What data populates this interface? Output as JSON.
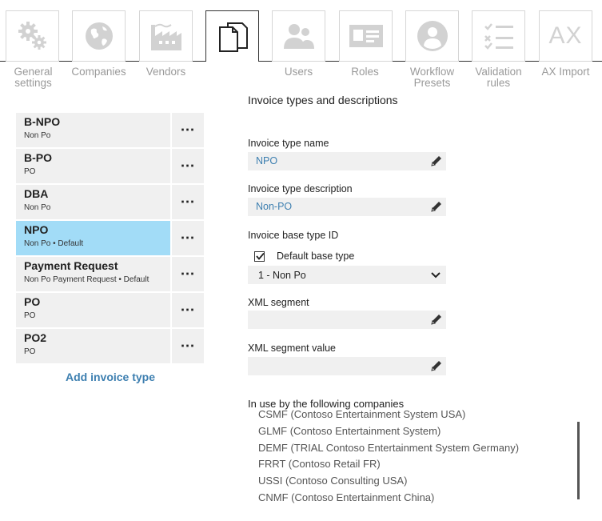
{
  "nav": {
    "items": [
      {
        "label": "General settings",
        "icon": "gears-icon"
      },
      {
        "label": "Companies",
        "icon": "globe-icon"
      },
      {
        "label": "Vendors",
        "icon": "factory-icon"
      },
      {
        "label": "",
        "icon": "documents-icon",
        "active": true
      },
      {
        "label": "Users",
        "icon": "users-icon"
      },
      {
        "label": "Roles",
        "icon": "id-card-icon"
      },
      {
        "label": "Workflow Presets",
        "icon": "user-circle-icon"
      },
      {
        "label": "Validation rules",
        "icon": "checklist-icon"
      },
      {
        "label": "AX Import",
        "icon": "ax-icon",
        "icon_text": "AX"
      }
    ]
  },
  "invoice_types": {
    "items": [
      {
        "name": "B-NPO",
        "sub": "Non Po",
        "selected": false
      },
      {
        "name": "B-PO",
        "sub": "PO",
        "selected": false
      },
      {
        "name": "DBA",
        "sub": "Non Po",
        "selected": false
      },
      {
        "name": "NPO",
        "sub": "Non Po • Default",
        "selected": true
      },
      {
        "name": "Payment Request",
        "sub": "Non Po Payment Request • Default",
        "selected": false
      },
      {
        "name": "PO",
        "sub": "PO",
        "selected": false
      },
      {
        "name": "PO2",
        "sub": "PO",
        "selected": false
      }
    ],
    "more_label": "⋯",
    "add_label": "Add invoice type"
  },
  "form": {
    "section_title": "Invoice types and descriptions",
    "name_label": "Invoice type name",
    "name_value": "NPO",
    "description_label": "Invoice type description",
    "description_value": "Non-PO",
    "base_type_label": "Invoice base type ID",
    "default_base_type_label": "Default base type",
    "default_base_type_checked": true,
    "base_type_value": "1 - Non Po",
    "xml_segment_label": "XML segment",
    "xml_segment_value": "",
    "xml_segment_value_label": "XML segment value",
    "xml_segment_value_value": ""
  },
  "companies": {
    "title": "In use by the following companies",
    "items": [
      "CSMF (Contoso Entertainment System USA)",
      "GLMF (Contoso Entertainment System)",
      "DEMF (TRIAL Contoso Entertainment System Germany)",
      "FRRT (Contoso Retail FR)",
      "USSI (Contoso Consulting USA)",
      "CNMF (Contoso Entertainment China)"
    ]
  },
  "colors": {
    "accent": "#3d7fb0",
    "selected_row": "#a2dcf7",
    "field_bg": "#f0f0f0",
    "nav_icon": "#d2d2d2"
  }
}
